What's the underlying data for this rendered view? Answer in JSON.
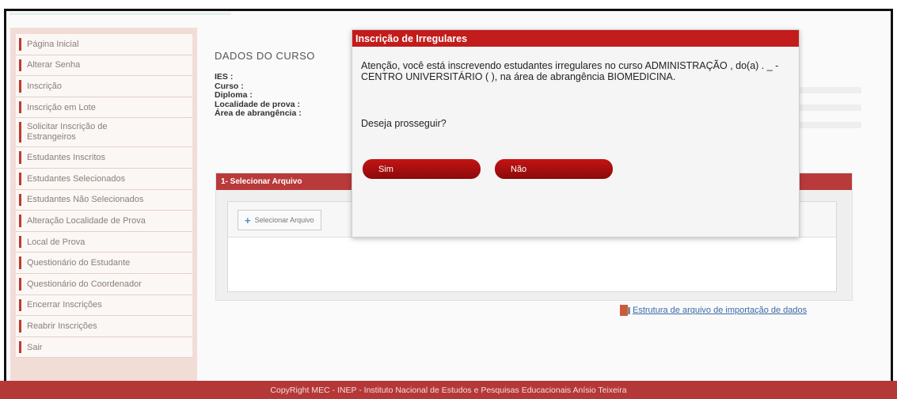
{
  "sidebar": {
    "items": [
      {
        "label": "Página Inicial"
      },
      {
        "label": "Alterar Senha"
      },
      {
        "label": "Inscrição"
      },
      {
        "label": "Inscrição em Lote"
      },
      {
        "label": "Solicitar Inscrição de Estrangeiros"
      },
      {
        "label": "Estudantes Inscritos"
      },
      {
        "label": "Estudantes Selecionados"
      },
      {
        "label": "Estudantes Não Selecionados"
      },
      {
        "label": "Alteração Localidade de Prova"
      },
      {
        "label": "Local de Prova"
      },
      {
        "label": "Questionário do Estudante"
      },
      {
        "label": "Questionário do Coordenador"
      },
      {
        "label": "Encerrar Inscrições"
      },
      {
        "label": "Reabrir Inscrições"
      },
      {
        "label": "Sair"
      }
    ]
  },
  "main": {
    "section_title": "DADOS DO CURSO",
    "fields": {
      "ies": "IES :",
      "curso": "Curso :",
      "diploma": "Diploma :",
      "localidade": "Localidade de prova :",
      "area": "Área de abrangência :"
    },
    "panel": {
      "header": "1- Selecionar Arquivo",
      "select_button": "Selecionar Arquivo"
    },
    "structure_link": "Estrutura de arquivo de importação de dados"
  },
  "footer": {
    "text": "CopyRight MEC - INEP - Instituto Nacional de Estudos e Pesquisas Educacionais Anísio Teixeira"
  },
  "modal": {
    "title": "Inscrição de Irregulares",
    "message": "Atenção, você está inscrevendo estudantes irregulares no curso ADMINISTRAÇÃO , do(a) . _ - CENTRO UNIVERSITÁRIO ( ), na área de abrangência BIOMEDICINA.",
    "question": "Deseja prosseguir?",
    "yes_label": "Sim",
    "no_label": "Não"
  },
  "colors": {
    "accent_red": "#c21c1c",
    "footer_red": "#b53838",
    "sidebar_bg": "#f2ddd6"
  }
}
